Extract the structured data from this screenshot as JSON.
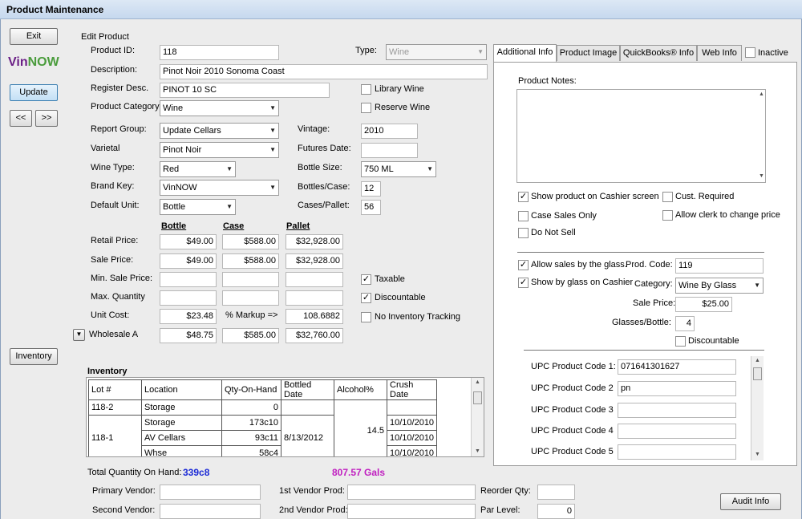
{
  "window": {
    "title": "Product Maintenance"
  },
  "left": {
    "exit": "Exit",
    "logo_a": "Vin",
    "logo_b": "NOW",
    "update": "Update",
    "prev": "<<",
    "next": ">>",
    "inventory": "Inventory"
  },
  "edit": {
    "section": "Edit Product",
    "product_id_label": "Product ID:",
    "product_id": "118",
    "type_label": "Type:",
    "type": "Wine",
    "description_label": "Description:",
    "description": "Pinot Noir 2010 Sonoma Coast",
    "register_label": "Register Desc.",
    "register": "PINOT 10 SC",
    "library_wine": "Library Wine",
    "reserve_wine": "Reserve Wine",
    "category_label": "Product Category:",
    "category": "Wine",
    "report_group_label": "Report Group:",
    "report_group": "Update Cellars",
    "varietal_label": "Varietal",
    "varietal": "Pinot Noir",
    "wine_type_label": "Wine Type:",
    "wine_type": "Red",
    "brand_key_label": "Brand Key:",
    "brand_key": "VinNOW",
    "default_unit_label": "Default Unit:",
    "default_unit": "Bottle",
    "vintage_label": "Vintage:",
    "vintage": "2010",
    "futures_label": "Futures Date:",
    "futures": "",
    "bottle_size_label": "Bottle Size:",
    "bottle_size": "750 ML",
    "bottles_case_label": "Bottles/Case:",
    "bottles_case": "12",
    "cases_pallet_label": "Cases/Pallet:",
    "cases_pallet": "56"
  },
  "pricing": {
    "col_bottle": "Bottle",
    "col_case": "Case",
    "col_pallet": "Pallet",
    "retail_label": "Retail Price:",
    "retail": [
      "$49.00",
      "$588.00",
      "$32,928.00"
    ],
    "sale_label": "Sale Price:",
    "sale": [
      "$49.00",
      "$588.00",
      "$32,928.00"
    ],
    "min_sale_label": "Min. Sale Price:",
    "max_qty_label": "Max. Quantity",
    "unit_cost_label": "Unit Cost:",
    "unit_cost": "$23.48",
    "markup_label": "% Markup =>",
    "markup": "108.6882",
    "wholesale_label": "Wholesale A",
    "wholesale": [
      "$48.75",
      "$585.00",
      "$32,760.00"
    ],
    "taxable": "Taxable",
    "discountable": "Discountable",
    "no_inventory": "No Inventory Tracking"
  },
  "inventory": {
    "title": "Inventory",
    "headers": [
      "Lot #",
      "Location",
      "Qty-On-Hand",
      "Bottled Date",
      "Alcohol%",
      "Crush Date"
    ],
    "lot1": "118-2",
    "lot1_loc": "Storage",
    "lot1_qty": "0",
    "lot2": "118-1",
    "lot2_bottled": "8/13/2012",
    "lot2_alcohol": "14.5",
    "rows": [
      {
        "loc": "Storage",
        "qty": "173c10",
        "crush": "10/10/2010"
      },
      {
        "loc": "AV Cellars",
        "qty": "93c11",
        "crush": "10/10/2010"
      },
      {
        "loc": "Whse",
        "qty": "58c4",
        "crush": "10/10/2010"
      }
    ],
    "total_label": "Total Quantity On Hand:",
    "total": "339c8",
    "gals": "807.57 Gals"
  },
  "vendors": {
    "primary_label": "Primary Vendor:",
    "second_label": "Second Vendor:",
    "first_prod_label": "1st Vendor Prod:",
    "second_prod_label": "2nd Vendor Prod:",
    "reorder_label": "Reorder Qty:",
    "par_label": "Par Level:",
    "par": "0",
    "audit": "Audit Info"
  },
  "tabs": {
    "additional": "Additional Info",
    "image": "Product Image",
    "quickbooks": "QuickBooks® Info",
    "web": "Web Info",
    "inactive": "Inactive"
  },
  "additional": {
    "notes_label": "Product Notes:",
    "show_cashier": "Show product on Cashier screen",
    "cust_required": "Cust. Required",
    "case_sales": "Case Sales Only",
    "allow_clerk": "Allow clerk to change price",
    "do_not_sell": "Do Not Sell",
    "allow_glass": "Allow sales by the glass.",
    "prod_code_label": "Prod. Code:",
    "prod_code": "119",
    "show_glass": "Show by glass on Cashier",
    "category_label": "Category:",
    "category": "Wine By Glass",
    "sale_price_label": "Sale Price:",
    "sale_price": "$25.00",
    "glasses_label": "Glasses/Bottle:",
    "glasses": "4",
    "discountable": "Discountable",
    "upc": [
      {
        "label": "UPC Product Code  1:",
        "value": "071641301627"
      },
      {
        "label": "UPC Product Code  2",
        "value": "pn"
      },
      {
        "label": "UPC Product Code  3",
        "value": ""
      },
      {
        "label": "UPC Product Code  4",
        "value": ""
      },
      {
        "label": "UPC Product Code  5",
        "value": ""
      }
    ]
  },
  "colors": {
    "total": "#1c2bd6",
    "gals": "#c020c0",
    "accent": "#3c7fb1"
  }
}
